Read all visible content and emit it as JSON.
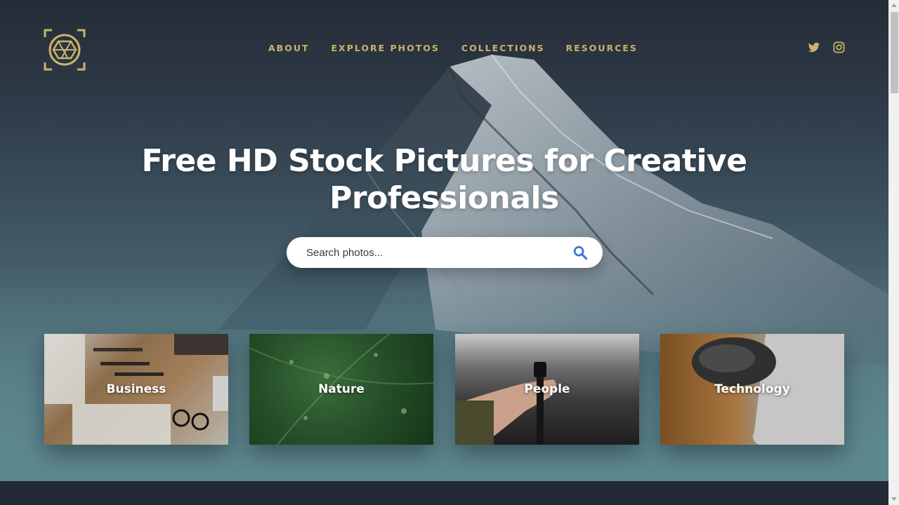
{
  "nav": {
    "items": [
      {
        "label": "ABOUT"
      },
      {
        "label": "EXPLORE PHOTOS"
      },
      {
        "label": "COLLECTIONS"
      },
      {
        "label": "RESOURCES"
      }
    ]
  },
  "social": {
    "icons": [
      "twitter-icon",
      "instagram-icon"
    ]
  },
  "hero": {
    "title_line1": "Free HD Stock Pictures for Creative",
    "title_line2": "Professionals"
  },
  "search": {
    "placeholder": "Search photos...",
    "value": "",
    "icon": "search-icon"
  },
  "categories": [
    {
      "label": "Business"
    },
    {
      "label": "Nature"
    },
    {
      "label": "People"
    },
    {
      "label": "Technology"
    }
  ],
  "colors": {
    "accent_gold": "#c9b46a",
    "search_icon_blue": "#3d74d6",
    "footer_dark": "#222a36"
  }
}
